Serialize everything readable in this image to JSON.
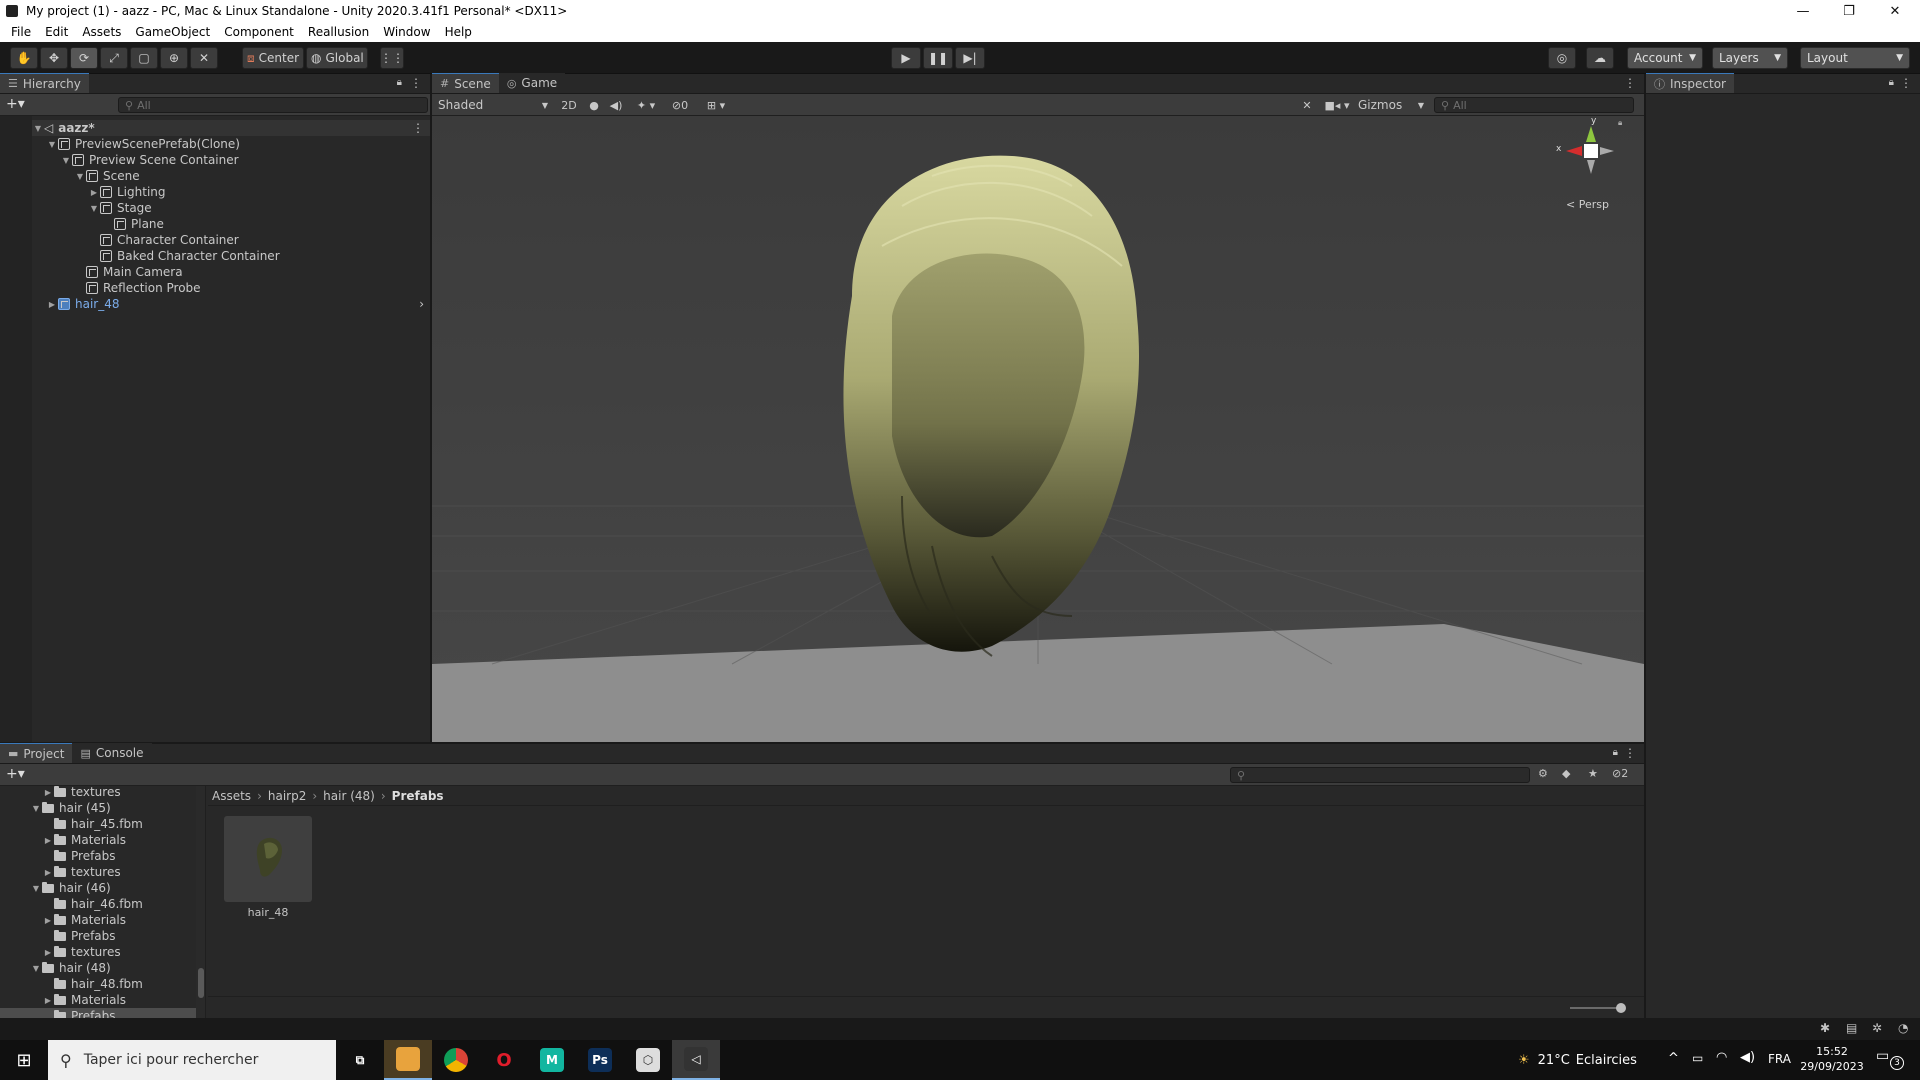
{
  "window": {
    "title": "My project (1) - aazz - PC, Mac & Linux Standalone - Unity 2020.3.41f1 Personal* <DX11>",
    "min_glyph": "—",
    "max_glyph": "❐",
    "close_glyph": "✕"
  },
  "menu": [
    "File",
    "Edit",
    "Assets",
    "GameObject",
    "Component",
    "Reallusion",
    "Window",
    "Help"
  ],
  "toolbar": {
    "pivot_label": "Center",
    "space_label": "Global",
    "account_label": "Account",
    "layers_label": "Layers",
    "layout_label": "Layout"
  },
  "hierarchy": {
    "tab_label": "Hierarchy",
    "search_placeholder": "All",
    "rows": [
      {
        "label": "aazz*",
        "depth": 0,
        "fold": "▼",
        "kind": "scene"
      },
      {
        "label": "PreviewScenePrefab(Clone)",
        "depth": 1,
        "fold": "▼",
        "kind": "go"
      },
      {
        "label": "Preview Scene Container",
        "depth": 2,
        "fold": "▼",
        "kind": "go"
      },
      {
        "label": "Scene",
        "depth": 3,
        "fold": "▼",
        "kind": "go"
      },
      {
        "label": "Lighting",
        "depth": 4,
        "fold": "▶",
        "kind": "go"
      },
      {
        "label": "Stage",
        "depth": 4,
        "fold": "▼",
        "kind": "go"
      },
      {
        "label": "Plane",
        "depth": 5,
        "fold": "",
        "kind": "go"
      },
      {
        "label": "Character Container",
        "depth": 4,
        "fold": "",
        "kind": "go"
      },
      {
        "label": "Baked Character Container",
        "depth": 4,
        "fold": "",
        "kind": "go"
      },
      {
        "label": "Main Camera",
        "depth": 3,
        "fold": "",
        "kind": "go"
      },
      {
        "label": "Reflection Probe",
        "depth": 3,
        "fold": "",
        "kind": "go"
      },
      {
        "label": "hair_48",
        "depth": 1,
        "fold": "▶",
        "kind": "prefab"
      }
    ]
  },
  "scene_view": {
    "tab_scene": "Scene",
    "tab_game": "Game",
    "shading_mode": "Shaded",
    "toggle_2d": "2D",
    "hidden_count": "0",
    "gizmos_label": "Gizmos",
    "search_placeholder": "All",
    "gizmo_y": "y",
    "gizmo_x": "x",
    "projection_label": "Persp"
  },
  "inspector": {
    "tab_label": "Inspector"
  },
  "project": {
    "tab_project": "Project",
    "tab_console": "Console",
    "hidden_count": "2",
    "breadcrumb": [
      "Assets",
      "hairp2",
      "hair (48)",
      "Prefabs"
    ],
    "tree": [
      {
        "label": "textures",
        "depth": 1,
        "fold": "▶"
      },
      {
        "label": "hair (45)",
        "depth": 0,
        "fold": "▼"
      },
      {
        "label": "hair_45.fbm",
        "depth": 1,
        "fold": ""
      },
      {
        "label": "Materials",
        "depth": 1,
        "fold": "▶"
      },
      {
        "label": "Prefabs",
        "depth": 1,
        "fold": ""
      },
      {
        "label": "textures",
        "depth": 1,
        "fold": "▶"
      },
      {
        "label": "hair (46)",
        "depth": 0,
        "fold": "▼"
      },
      {
        "label": "hair_46.fbm",
        "depth": 1,
        "fold": ""
      },
      {
        "label": "Materials",
        "depth": 1,
        "fold": "▶"
      },
      {
        "label": "Prefabs",
        "depth": 1,
        "fold": ""
      },
      {
        "label": "textures",
        "depth": 1,
        "fold": "▶"
      },
      {
        "label": "hair (48)",
        "depth": 0,
        "fold": "▼"
      },
      {
        "label": "hair_48.fbm",
        "depth": 1,
        "fold": ""
      },
      {
        "label": "Materials",
        "depth": 1,
        "fold": "▶"
      },
      {
        "label": "Prefabs",
        "depth": 1,
        "fold": "",
        "selected": true
      }
    ],
    "assets": [
      {
        "label": "hair_48"
      }
    ]
  },
  "taskbar": {
    "search_placeholder": "Taper ici pour rechercher",
    "weather_temp": "21°C",
    "weather_desc": "Eclaircies",
    "language": "FRA",
    "time": "15:52",
    "date": "29/09/2023",
    "notifications": "3",
    "apps": [
      {
        "name": "task-view-icon",
        "label": "⧉"
      },
      {
        "name": "file-explorer-icon",
        "label": ""
      },
      {
        "name": "chrome-icon",
        "label": ""
      },
      {
        "name": "opera-icon",
        "label": "O"
      },
      {
        "name": "maya-icon",
        "label": "M"
      },
      {
        "name": "photoshop-icon",
        "label": "Ps"
      },
      {
        "name": "unity-hub-icon",
        "label": "⬡"
      },
      {
        "name": "unity-editor-icon",
        "label": "◁"
      }
    ]
  },
  "colors": {
    "selection_blue": "#3a79bb",
    "prefab_blue": "#7bacea",
    "hair_light": "#c9c98e",
    "hair_dark": "#1c1c10"
  }
}
